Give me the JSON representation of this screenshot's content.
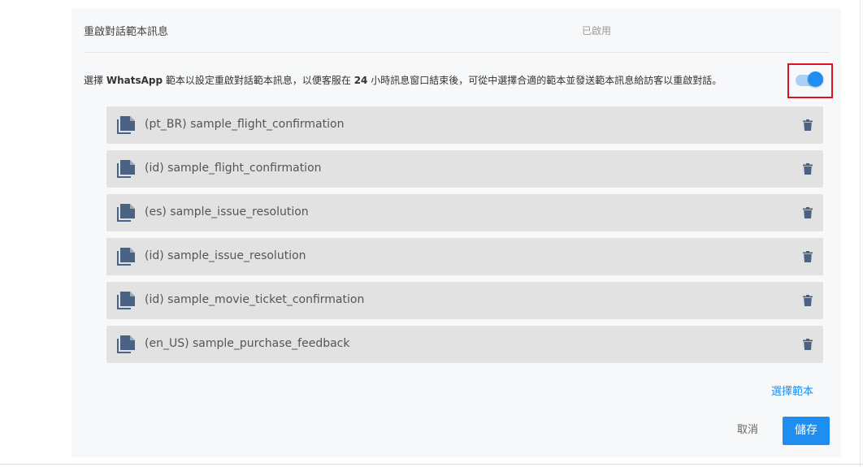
{
  "status": {
    "label": "重啟對話範本訊息",
    "value": "已啟用"
  },
  "description": {
    "part1": "選擇 ",
    "bold1": "WhatsApp",
    "part2": " 範本以設定重啟對話範本訊息，以便客服在 ",
    "bold2": "24",
    "part3": " 小時訊息窗口結束後，可從中選擇合適的範本並發送範本訊息給訪客以重啟對話。"
  },
  "toggle": {
    "enabled": true,
    "colors": {
      "track": "#a9d1f5",
      "knob": "#1e8ef1"
    }
  },
  "templates": [
    {
      "name": "(pt_BR) sample_flight_confirmation",
      "icon": "copy-document-icon",
      "action_icon": "trash-icon"
    },
    {
      "name": "(id) sample_flight_confirmation",
      "icon": "copy-document-icon",
      "action_icon": "trash-icon"
    },
    {
      "name": "(es) sample_issue_resolution",
      "icon": "copy-document-icon",
      "action_icon": "trash-icon"
    },
    {
      "name": "(id) sample_issue_resolution",
      "icon": "copy-document-icon",
      "action_icon": "trash-icon"
    },
    {
      "name": "(id) sample_movie_ticket_confirmation",
      "icon": "copy-document-icon",
      "action_icon": "trash-icon"
    },
    {
      "name": "(en_US) sample_purchase_feedback",
      "icon": "copy-document-icon",
      "action_icon": "trash-icon"
    }
  ],
  "actions": {
    "select_template": "選擇範本",
    "cancel": "取消",
    "save": "儲存"
  },
  "colors": {
    "accent": "#1e8ef1",
    "icon": "#4a6283",
    "highlight_border": "#d9141c"
  }
}
